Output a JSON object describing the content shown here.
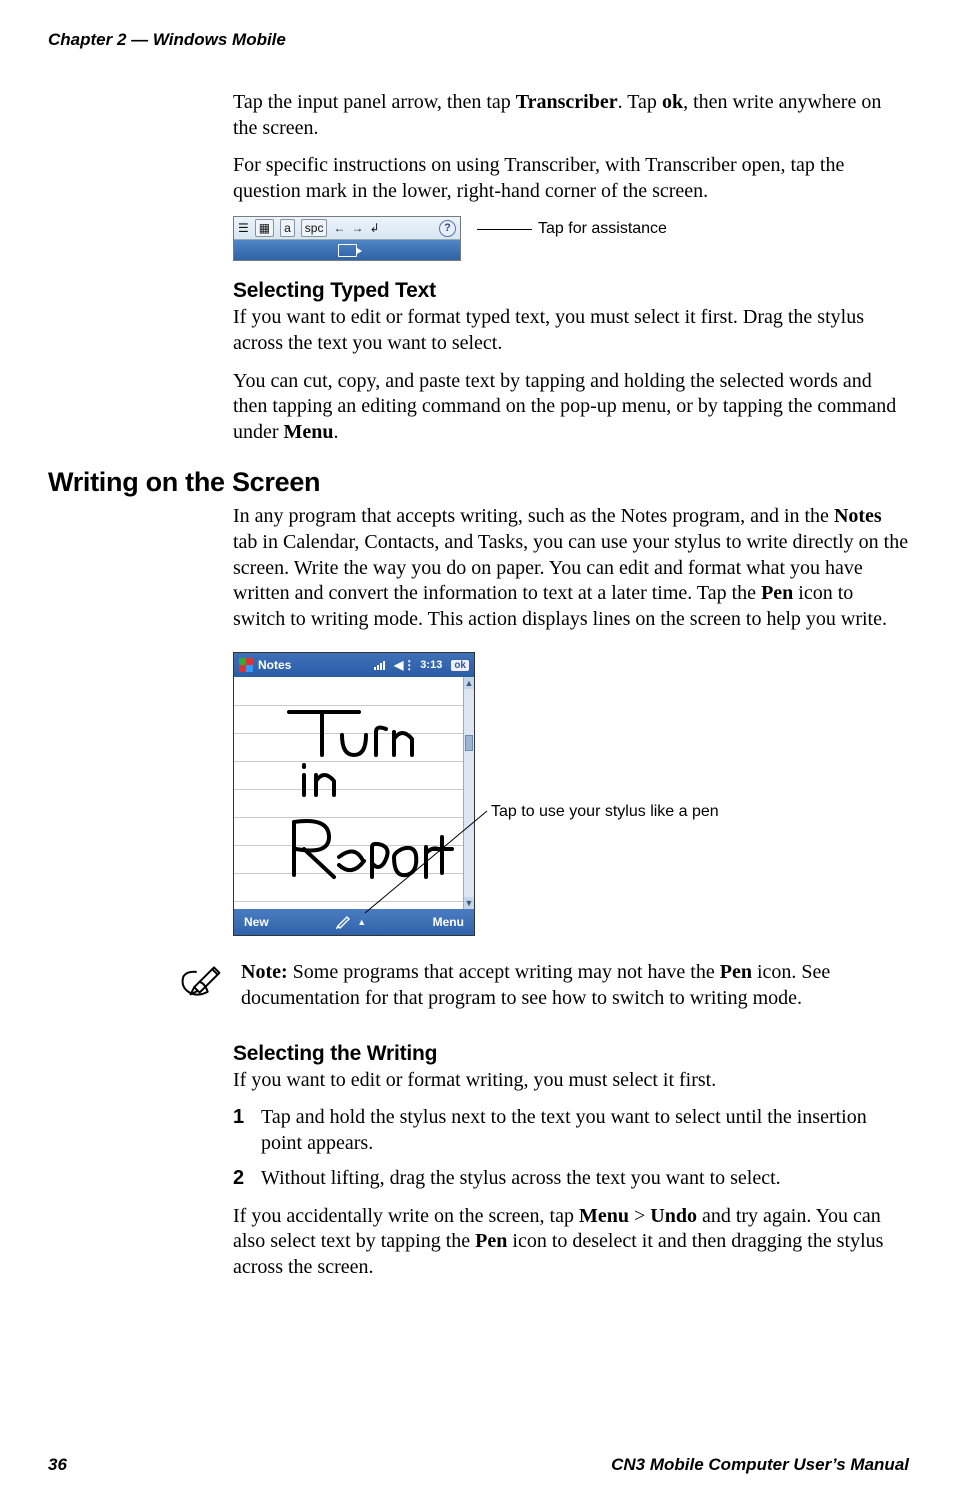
{
  "header": {
    "chapter": "Chapter 2 — Windows Mobile"
  },
  "intro": {
    "p1_a": "Tap the input panel arrow, then tap ",
    "p1_b": "Transcriber",
    "p1_c": ". Tap ",
    "p1_d": "ok",
    "p1_e": ", then write anywhere on the screen.",
    "p2": "For specific instructions on using Transcriber, with Transcriber open, tap the question mark in the lower, right-hand corner of the screen."
  },
  "toolbar": {
    "spc": "spc",
    "a": "a",
    "help": "?",
    "callout": "Tap for assistance"
  },
  "typed": {
    "heading": "Selecting Typed Text",
    "p1": "If you want to edit or format typed text, you must select it first. Drag the stylus across the text you want to select.",
    "p2_a": "You can cut, copy, and paste text by tapping and holding the selected words and then tapping an editing command on the pop-up menu, or by tapping the command under ",
    "p2_b": "Menu",
    "p2_c": "."
  },
  "writing": {
    "heading": "Writing on the Screen",
    "p1_a": "In any program that accepts writing, such as the Notes program, and in the ",
    "p1_b": "Notes",
    "p1_c": " tab in Calendar, Contacts, and Tasks, you can use your stylus to write directly on the screen. Write the way you do on paper. You can edit and format what you have written and convert the information to text at a later time. Tap the ",
    "p1_d": "Pen",
    "p1_e": " icon to switch to writing mode. This action displays lines on the screen to help you write."
  },
  "notes_app": {
    "title": "Notes",
    "clock": "3:13",
    "ok": "ok",
    "new": "New",
    "menu": "Menu",
    "callout": "Tap to use your stylus like a pen"
  },
  "note_block": {
    "a": "Note:",
    "b": " Some programs that accept writing may not have the ",
    "c": "Pen",
    "d": " icon. See documentation for that program to see how to switch to writing mode."
  },
  "sel_writing": {
    "heading": "Selecting the Writing",
    "p1": "If you want to edit or format writing, you must select it first.",
    "steps": [
      {
        "n": "1",
        "text": "Tap and hold the stylus next to the text you want to select until the insertion point appears."
      },
      {
        "n": "2",
        "text": "Without lifting, drag the stylus across the text you want to select."
      }
    ],
    "p2_a": "If you accidentally write on the screen, tap ",
    "p2_b": "Menu",
    "p2_c": " > ",
    "p2_d": "Undo",
    "p2_e": " and try again. You can also select text by tapping the ",
    "p2_f": "Pen",
    "p2_g": " icon to deselect it and then dragging the stylus across the screen."
  },
  "footer": {
    "page": "36",
    "manual": "CN3 Mobile Computer User’s Manual"
  }
}
